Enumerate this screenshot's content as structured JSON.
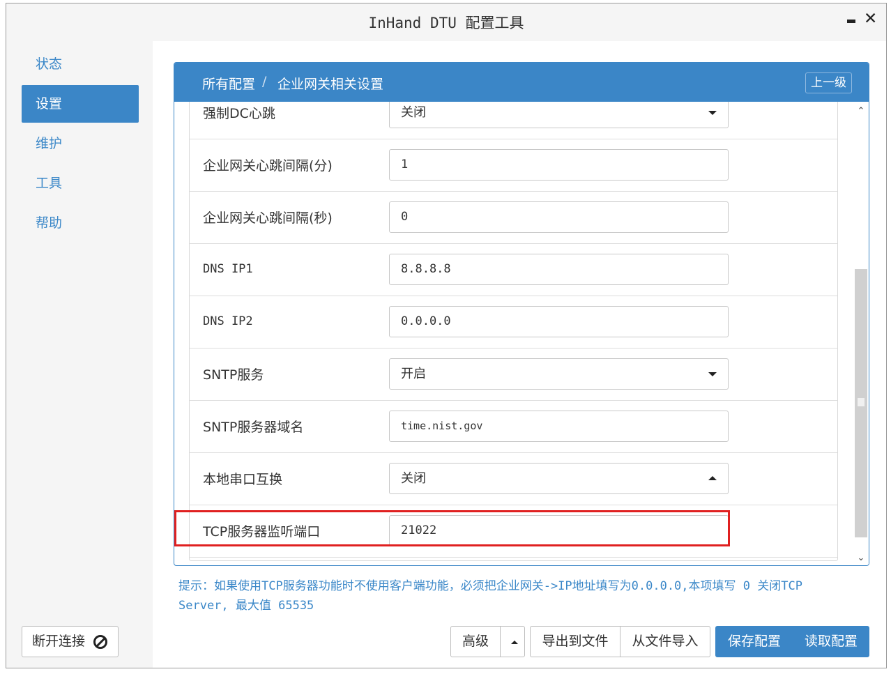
{
  "window": {
    "title": "InHand DTU 配置工具",
    "minimize_icon": "minimize-icon",
    "close_icon": "close-icon"
  },
  "sidebar": {
    "items": [
      {
        "label": "状态",
        "active": false
      },
      {
        "label": "设置",
        "active": true
      },
      {
        "label": "维护",
        "active": false
      },
      {
        "label": "工具",
        "active": false
      },
      {
        "label": "帮助",
        "active": false
      }
    ],
    "disconnect_label": "断开连接",
    "disconnect_icon": "ban-icon"
  },
  "panel": {
    "breadcrumb": [
      "所有配置",
      "企业网关相关设置"
    ],
    "breadcrumb_separator": "/",
    "up_label": "上一级",
    "rows": [
      {
        "label": "强制DC心跳",
        "value": "关闭",
        "type": "select"
      },
      {
        "label": "企业网关心跳间隔(分)",
        "value": "1",
        "type": "input"
      },
      {
        "label": "企业网关心跳间隔(秒)",
        "value": "0",
        "type": "input"
      },
      {
        "label": "DNS IP1",
        "value": "8.8.8.8",
        "type": "input"
      },
      {
        "label": "DNS IP2",
        "value": "0.0.0.0",
        "type": "input"
      },
      {
        "label": "SNTP服务",
        "value": "开启",
        "type": "select"
      },
      {
        "label": "SNTP服务器域名",
        "value": "time.nist.gov",
        "type": "input"
      },
      {
        "label": "本地串口互换",
        "value": "关闭",
        "type": "select-open"
      },
      {
        "label": "TCP服务器监听端口",
        "value": "21022",
        "type": "input",
        "highlighted": true
      }
    ]
  },
  "hint": {
    "line1": "提示：如果使用TCP服务器功能时不使用客户端功能，必须把企业网关->IP地址填写为0.0.0.0,本项填写 0 关闭TCP",
    "line2": "Server, 最大值 65535"
  },
  "buttons": {
    "advanced": "高级",
    "export": "导出到文件",
    "import": "从文件导入",
    "save": "保存配置",
    "read": "读取配置"
  },
  "colors": {
    "accent": "#3b86c7",
    "highlight_border": "#e02020"
  }
}
